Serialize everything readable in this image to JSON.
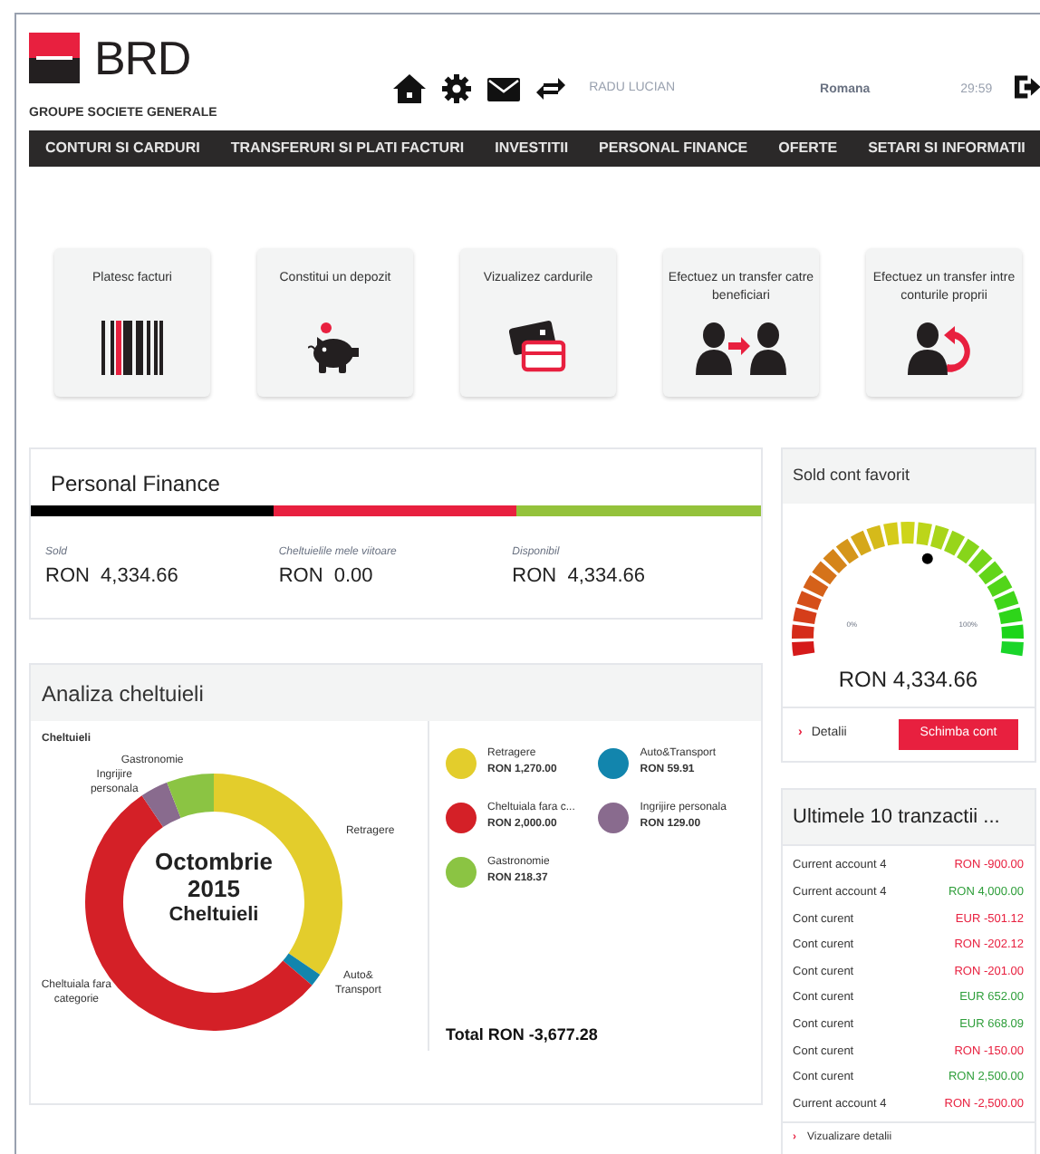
{
  "header": {
    "logo": "BRD",
    "tagline": "GROUPE SOCIETE GENERALE",
    "user": "RADU LUCIAN",
    "language": "Romana",
    "session_timer": "29:59"
  },
  "nav": [
    {
      "label": "CONTURI SI CARDURI",
      "selected": false
    },
    {
      "label": "TRANSFERURI SI PLATI FACTURI",
      "selected": false
    },
    {
      "label": "INVESTITII",
      "selected": false
    },
    {
      "label": "PERSONAL FINANCE",
      "selected": false
    },
    {
      "label": "OFERTE",
      "selected": false
    },
    {
      "label": "SETARI SI INFORMATII",
      "selected": false
    }
  ],
  "shortcuts": [
    {
      "label": "Platesc facturi",
      "kind": "barcode"
    },
    {
      "label": "Constitui un depozit",
      "kind": "piggy"
    },
    {
      "label": "Vizualizez cardurile",
      "kind": "cards"
    },
    {
      "label": "Efectuez un transfer catre beneficiari",
      "kind": "transfer"
    },
    {
      "label": "Efectuez un transfer intre conturile proprii",
      "kind": "own"
    }
  ],
  "personal_finance": {
    "title": "Personal Finance",
    "items": [
      {
        "label": "Sold",
        "value": "RON  4,334.66",
        "color": "#000000"
      },
      {
        "label": "Cheltuielile mele viitoare",
        "value": "RON  0.00",
        "color": "#e8203f"
      },
      {
        "label": "Disponibil",
        "value": "RON  4,334.66",
        "color": "#94c23b"
      }
    ]
  },
  "favorite_account": {
    "title": "Sold cont favorit",
    "gauge_min": "0%",
    "gauge_max": "100%",
    "level": 0.57,
    "balance": "RON 4,334.66",
    "details_chevron": "›",
    "details_link": "Detalii",
    "change_button": "Schimba cont"
  },
  "expense_analysis": {
    "title": "Analiza cheltuieli",
    "center_month": "Octombrie",
    "center_year": "2015",
    "chart_data": {
      "type": "donut",
      "title": "Cheltuieli",
      "categories": [
        "Retragere",
        "Auto& Transport",
        "Cheltuiala fara categorie",
        "Ingrijire personala",
        "Gastronomie"
      ],
      "series": [
        {
          "name": "Cheltuieli",
          "values": [
            34.54,
            1.63,
            54.38,
            3.51,
            5.94
          ]
        }
      ]
    },
    "legend": [
      {
        "name": "Retragere",
        "amount": "RON 1,270.00",
        "color": "#e3cd2c"
      },
      {
        "name": "Auto&Transport",
        "amount": "RON 59.91",
        "color": "#1285ad"
      },
      {
        "name": "Cheltuiala fara c...",
        "amount": "RON 2,000.00",
        "color": "#d42027"
      },
      {
        "name": "Ingrijire personala",
        "amount": "RON 129.00",
        "color": "#896b8e"
      },
      {
        "name": "Gastronomie",
        "amount": "RON 218.37",
        "color": "#8bc443"
      }
    ],
    "total": "Total RON -3,677.28"
  },
  "transactions": {
    "title": "Ultimele 10 tranzactii ...",
    "rows": [
      {
        "account": "Current account 4",
        "amount": "RON -900.00",
        "kind": "debit"
      },
      {
        "account": "Current account 4",
        "amount": "RON 4,000.00",
        "kind": "credit"
      },
      {
        "account": "Cont curent",
        "amount": "EUR -501.12",
        "kind": "debit"
      },
      {
        "account": "Cont curent",
        "amount": "RON -202.12",
        "kind": "debit"
      },
      {
        "account": "Cont curent",
        "amount": "RON -201.00",
        "kind": "debit"
      },
      {
        "account": "Cont curent",
        "amount": "EUR 652.00",
        "kind": "credit"
      },
      {
        "account": "Cont curent",
        "amount": "EUR 668.09",
        "kind": "credit"
      },
      {
        "account": "Cont curent",
        "amount": "RON -150.00",
        "kind": "debit"
      },
      {
        "account": "Cont curent",
        "amount": "RON 2,500.00",
        "kind": "credit"
      },
      {
        "account": "Current account 4",
        "amount": "RON -2,500.00",
        "kind": "debit"
      }
    ],
    "details_chevron": "›",
    "details_link": "Vizualizare detalii"
  }
}
